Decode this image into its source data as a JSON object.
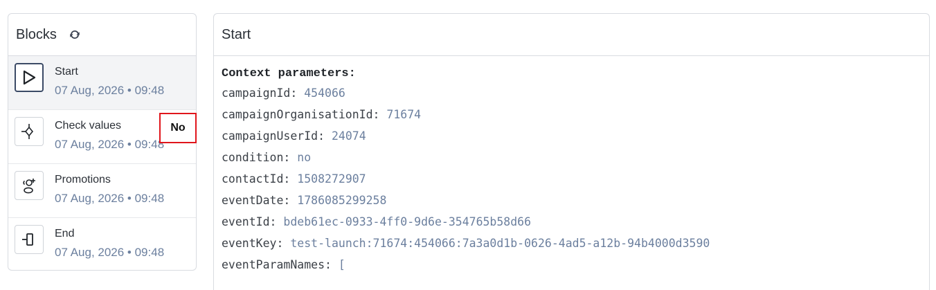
{
  "blocks_panel": {
    "title": "Blocks",
    "refresh_icon": "refresh-icon",
    "items": [
      {
        "name": "Start",
        "date": "07 Aug, 2026 • 09:48",
        "icon": "play-icon",
        "active": true
      },
      {
        "name": "Check values",
        "date": "07 Aug, 2026 • 09:48",
        "icon": "decision-icon",
        "badge": "No"
      },
      {
        "name": "Promotions",
        "date": "07 Aug, 2026 • 09:48",
        "icon": "users-add-icon"
      },
      {
        "name": "End",
        "date": "07 Aug, 2026 • 09:48",
        "icon": "end-icon"
      }
    ]
  },
  "detail_panel": {
    "title": "Start",
    "context_title": "Context parameters:",
    "params": [
      {
        "key": "campaignId:",
        "value": "454066"
      },
      {
        "key": "campaignOrganisationId:",
        "value": "71674"
      },
      {
        "key": "campaignUserId:",
        "value": "24074"
      },
      {
        "key": "condition:",
        "value": "no"
      },
      {
        "key": "contactId:",
        "value": "1508272907"
      },
      {
        "key": "eventDate:",
        "value": "1786085299258"
      },
      {
        "key": "eventId:",
        "value": "bdeb61ec-0933-4ff0-9d6e-354765b58d66"
      },
      {
        "key": "eventKey:",
        "value": "test-launch:71674:454066:7a3a0d1b-0626-4ad5-a12b-94b4000d3590"
      },
      {
        "key": "eventParamNames:",
        "value": "["
      }
    ]
  },
  "colors": {
    "border": "#d8dbe0",
    "value_text": "#6b7f9e",
    "highlight_red": "#e0151b",
    "active_bg": "#f3f4f6"
  }
}
